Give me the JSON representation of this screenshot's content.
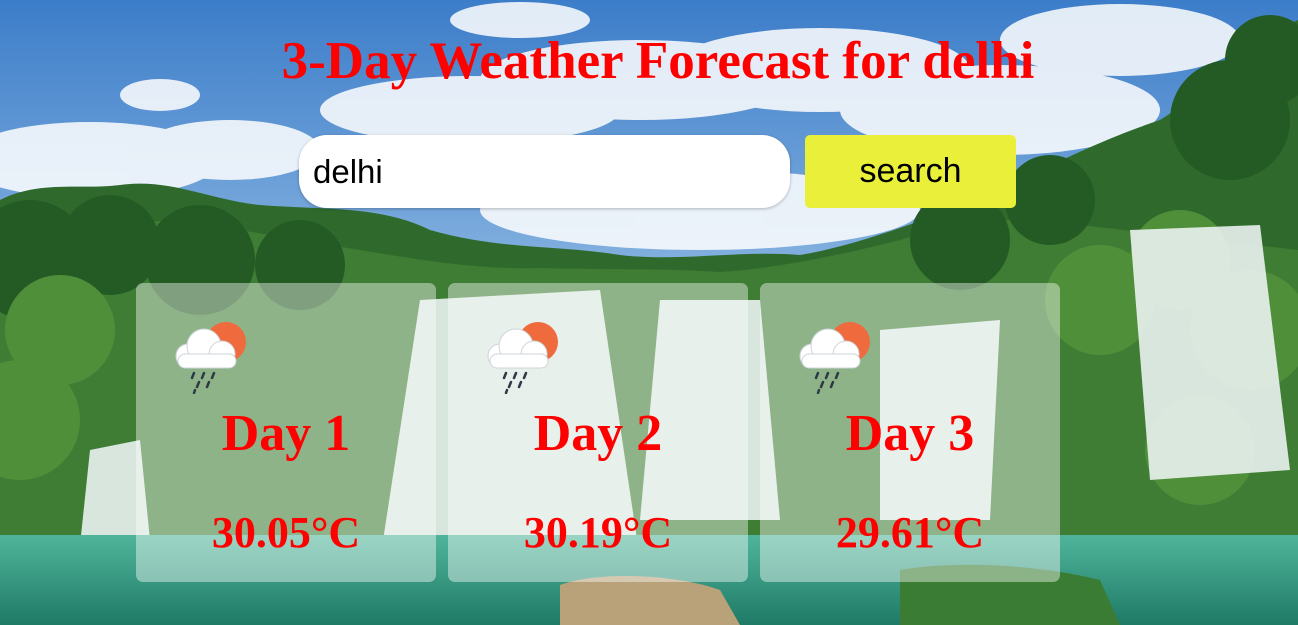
{
  "header": {
    "title": "3-Day Weather Forecast for delhi"
  },
  "search": {
    "value": "delhi",
    "button_label": "search"
  },
  "forecast": [
    {
      "day": "Day 1",
      "temp": "30.05°C",
      "icon": "rain-cloud-sun-icon"
    },
    {
      "day": "Day 2",
      "temp": "30.19°C",
      "icon": "rain-cloud-sun-icon"
    },
    {
      "day": "Day 3",
      "temp": "29.61°C",
      "icon": "rain-cloud-sun-icon"
    }
  ],
  "colors": {
    "title": "#ff0000",
    "button": "#eaf03a",
    "card": "rgba(255,255,255,0.42)",
    "sun": "#ef6a3c",
    "rain": "#2f3a45"
  }
}
